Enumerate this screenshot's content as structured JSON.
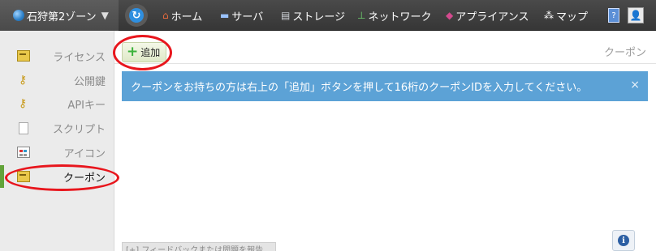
{
  "topbar": {
    "zone_label": "石狩第2ゾーン",
    "zone_caret": "▼",
    "refresh_icon": "↻",
    "nav": [
      {
        "label": "ホーム",
        "icon": "home-icon",
        "glyph": "⌂"
      },
      {
        "label": "サーバ",
        "icon": "server-icon",
        "glyph": "▬"
      },
      {
        "label": "ストレージ",
        "icon": "storage-icon",
        "glyph": "▤"
      },
      {
        "label": "ネットワーク",
        "icon": "network-icon",
        "glyph": "⊥"
      },
      {
        "label": "アプライアンス",
        "icon": "appliance-icon",
        "glyph": "◆"
      },
      {
        "label": "マップ",
        "icon": "map-icon",
        "glyph": "⁂"
      }
    ],
    "help_glyph": "?",
    "user_glyph": "👤"
  },
  "sidebar": {
    "items": [
      {
        "label": "ライセンス",
        "icon": "license-icon"
      },
      {
        "label": "公開鍵",
        "icon": "key-icon"
      },
      {
        "label": "APIキー",
        "icon": "api-key-icon"
      },
      {
        "label": "スクリプト",
        "icon": "script-icon"
      },
      {
        "label": "アイコン",
        "icon": "icon-library-icon"
      },
      {
        "label": "クーポン",
        "icon": "coupon-icon",
        "active": true
      }
    ]
  },
  "main": {
    "add_button_label": "追加",
    "add_glyph": "+",
    "section_title": "クーポン",
    "alert_text": "クーポンをお持ちの方は右上の「追加」ボタンを押して16桁のクーポンIDを入力してください。",
    "alert_close": "×",
    "feedback_label": "[+] フィードバックまたは問題を報告",
    "info_glyph": "i"
  },
  "colors": {
    "topbar": "#3f3f3f",
    "sidebar": "#ebebeb",
    "active_marker": "#62a33a",
    "alert_bg": "#5ca2d6",
    "annotation_red": "#e8161d"
  }
}
